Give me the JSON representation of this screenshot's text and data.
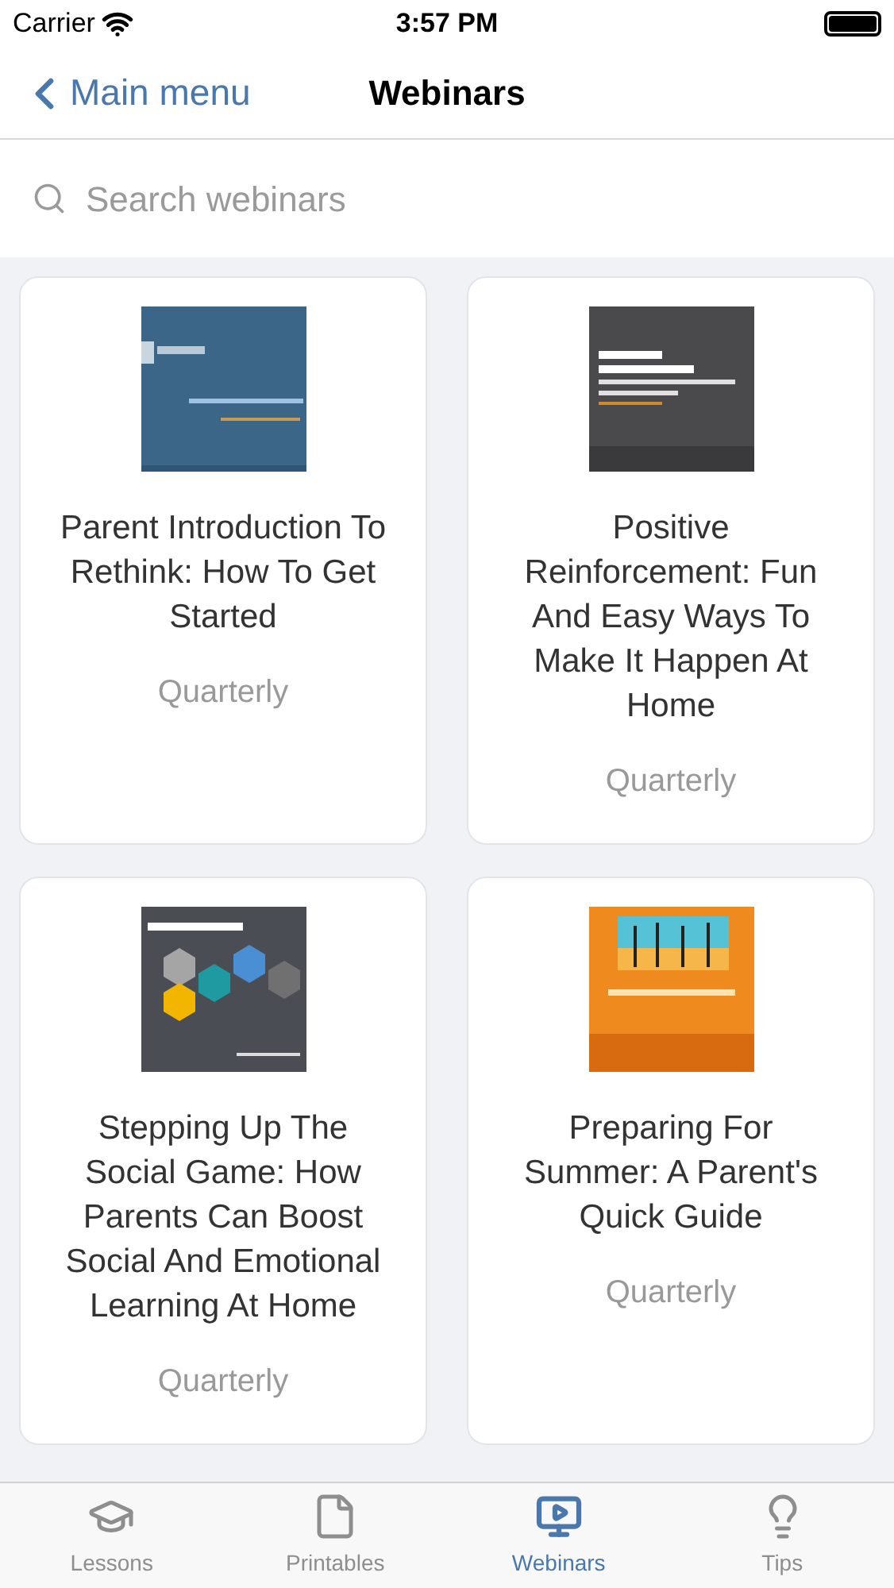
{
  "status_bar": {
    "carrier": "Carrier",
    "time": "3:57 PM"
  },
  "nav": {
    "back": "Main menu",
    "title": "Webinars"
  },
  "search": {
    "placeholder": "Search webinars"
  },
  "webinars": [
    {
      "title": "Parent Introduction To Rethink: How To Get Started",
      "frequency": "Quarterly"
    },
    {
      "title": "Positive Reinforcement: Fun And Easy Ways To Make It Happen At Home",
      "frequency": "Quarterly"
    },
    {
      "title": "Stepping Up The Social Game: How Parents Can Boost Social And Emotional Learning At Home",
      "frequency": "Quarterly"
    },
    {
      "title": "Preparing For Summer: A Parent's Quick Guide",
      "frequency": "Quarterly"
    }
  ],
  "tabs": [
    {
      "label": "Lessons",
      "selected": false
    },
    {
      "label": "Printables",
      "selected": false
    },
    {
      "label": "Webinars",
      "selected": true
    },
    {
      "label": "Tips",
      "selected": false
    }
  ]
}
